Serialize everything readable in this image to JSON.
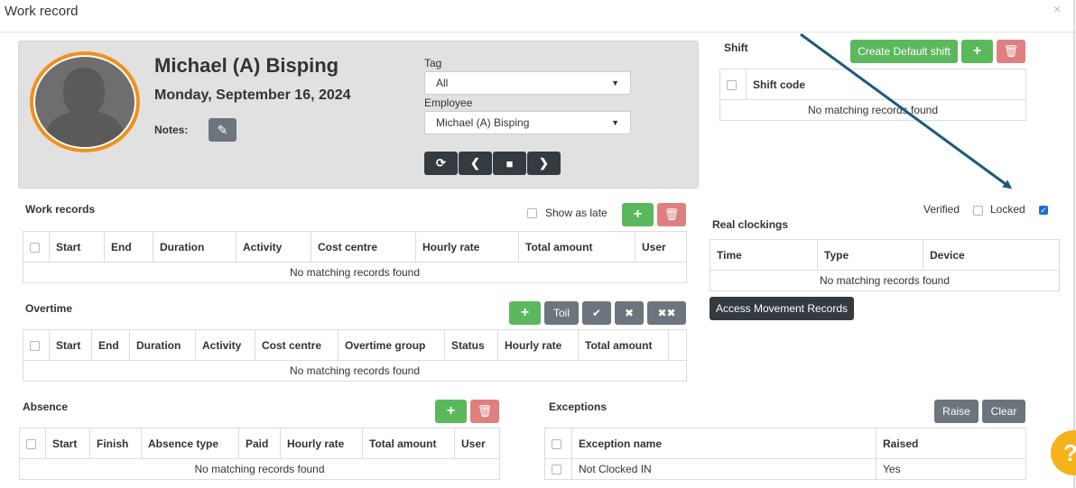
{
  "modal": {
    "title": "Work record",
    "close": "×"
  },
  "employee": {
    "name": "Michael (A) Bisping",
    "date": "Monday, September 16, 2024",
    "notes_label": "Notes:",
    "tag_label": "Tag",
    "tag_value": "All",
    "employee_label": "Employee",
    "employee_value": "Michael (A) Bisping"
  },
  "nav": {
    "refresh": "⟳",
    "prev": "❮",
    "stop": "■",
    "next": "❯"
  },
  "work_records": {
    "title": "Work records",
    "show_as_late": "Show as late",
    "columns": [
      "Start",
      "End",
      "Duration",
      "Activity",
      "Cost centre",
      "Hourly rate",
      "Total amount",
      "User"
    ],
    "empty": "No matching records found"
  },
  "overtime": {
    "title": "Overtime",
    "toil_label": "Toil",
    "columns": [
      "Start",
      "End",
      "Duration",
      "Activity",
      "Cost centre",
      "Overtime group",
      "Status",
      "Hourly rate",
      "Total amount"
    ],
    "empty": "No matching records found"
  },
  "absence": {
    "title": "Absence",
    "columns": [
      "Start",
      "Finish",
      "Absence type",
      "Paid",
      "Hourly rate",
      "Total amount",
      "User"
    ],
    "empty": "No matching records found"
  },
  "shift": {
    "title": "Shift",
    "create_default": "Create Default shift",
    "columns": [
      "Shift code"
    ],
    "empty": "No matching records found"
  },
  "status": {
    "verified": "Verified",
    "locked": "Locked",
    "locked_checked": true
  },
  "real_clockings": {
    "title": "Real clockings",
    "columns": [
      "Time",
      "Type",
      "Device"
    ],
    "empty": "No matching records found",
    "access_button": "Access Movement Records"
  },
  "exceptions": {
    "title": "Exceptions",
    "raise": "Raise",
    "clear": "Clear",
    "columns": [
      "Exception name",
      "Raised"
    ],
    "rows": [
      {
        "name": "Not Clocked IN",
        "raised": "Yes"
      }
    ]
  },
  "help": {
    "label": "?"
  },
  "colors": {
    "accent_green": "#5cb85c",
    "danger": "#e07f80",
    "avatar_ring": "#f0901e",
    "arrow": "#1d5a7a",
    "help": "#f5b31b"
  },
  "icons": [
    "close-icon",
    "edit-icon",
    "refresh-icon",
    "chevron-left-icon",
    "stop-icon",
    "chevron-right-icon",
    "plus-icon",
    "trash-icon",
    "check-icon",
    "x-icon",
    "double-x-icon",
    "help-icon"
  ]
}
